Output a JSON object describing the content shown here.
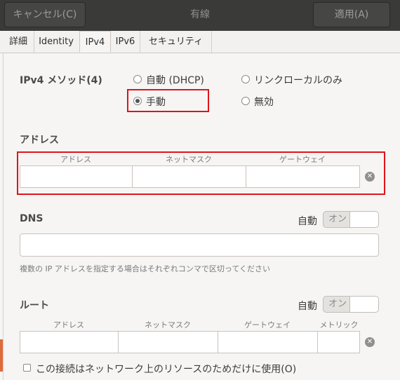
{
  "header": {
    "cancel_label": "キャンセル(C)",
    "title": "有線",
    "apply_label": "適用(A)"
  },
  "tabs": [
    "詳細",
    "Identity",
    "IPv4",
    "IPv6",
    "セキュリティ"
  ],
  "active_tab": "IPv4",
  "ipv4": {
    "method_label": "IPv4 メソッド(4)",
    "options": {
      "dhcp": "自動 (DHCP)",
      "link_local": "リンクローカルのみ",
      "manual": "手動",
      "disabled": "無効"
    },
    "selected": "手動"
  },
  "address": {
    "section_label": "アドレス",
    "columns": [
      "アドレス",
      "ネットマスク",
      "ゲートウェイ"
    ],
    "row": [
      "",
      "",
      ""
    ]
  },
  "dns": {
    "section_label": "DNS",
    "auto_label": "自動",
    "switch_label": "オン",
    "value": "",
    "hint": "複数の IP アドレスを指定する場合はそれぞれコンマで区切ってください"
  },
  "routes": {
    "section_label": "ルート",
    "auto_label": "自動",
    "switch_label": "オン",
    "columns": [
      "アドレス",
      "ネットマスク",
      "ゲートウェイ",
      "メトリック"
    ],
    "row": [
      "",
      "",
      "",
      ""
    ]
  },
  "only_local_label": "この接続はネットワーク上のリソースのためだけに使用(O)"
}
